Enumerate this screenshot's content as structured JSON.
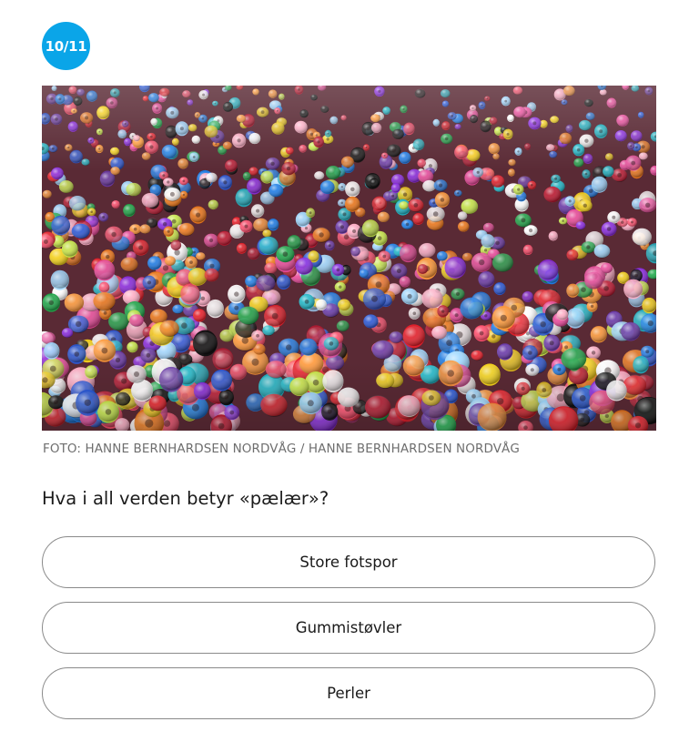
{
  "quiz": {
    "progress_label": "10/11",
    "progress_current": 10,
    "progress_total": 11,
    "photo_caption": "FOTO: HANNE BERNHARDSEN NORDVÅG / HANNE BERNHARDSEN NORDVÅG",
    "question": "Hva i all verden betyr «pælær»?",
    "answers": [
      {
        "label": "Store fotspor"
      },
      {
        "label": "Gummistøvler"
      },
      {
        "label": "Perler"
      }
    ]
  },
  "colors": {
    "badge": "#0aa5e8",
    "border": "#8a8a8a",
    "caption": "#6e6e6e"
  }
}
